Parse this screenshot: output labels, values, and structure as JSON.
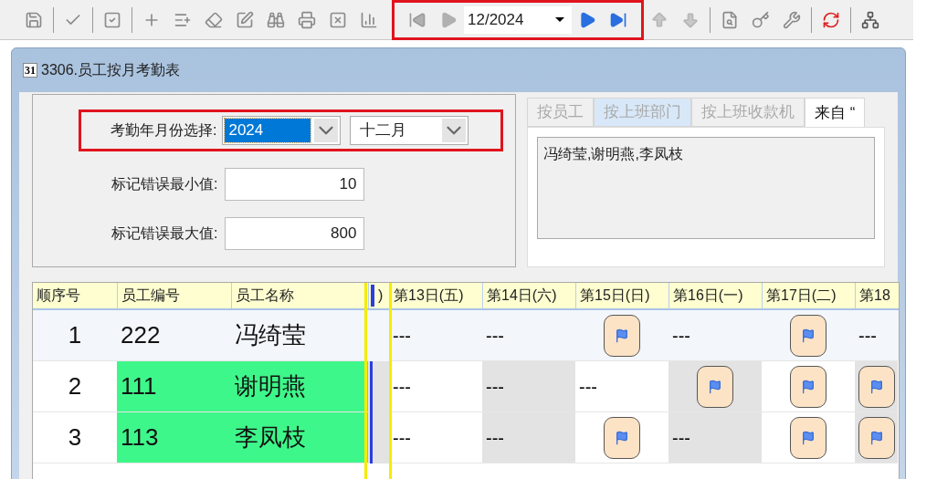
{
  "toolbar": {
    "period": "12/2024"
  },
  "window": {
    "title": "3306.员工按月考勤表",
    "icon_text": "31"
  },
  "filter": {
    "period_label": "考勤年月份选择:",
    "year": "2024",
    "month": "十二月",
    "min_label": "标记错误最小值:",
    "min_value": "10",
    "max_label": "标记错误最大值:",
    "max_value": "800"
  },
  "tabs": [
    {
      "label": "按员工",
      "selected": false,
      "hovered": false
    },
    {
      "label": "按上班部门",
      "selected": false,
      "hovered": true
    },
    {
      "label": "按上班收款机",
      "selected": false,
      "hovered": false
    },
    {
      "label": "来自 “",
      "selected": true,
      "hovered": false
    }
  ],
  "tab_content": "冯绮莹,谢明燕,李凤枝",
  "table": {
    "columns": [
      "顺序号",
      "员工编号",
      "员工名称",
      ")",
      "第13日(五)",
      "第14日(六)",
      "第15日(日)",
      "第16日(一)",
      "第17日(二)",
      "第18"
    ],
    "rows": [
      {
        "seq": "1",
        "id": "222",
        "name": "冯绮莹",
        "selected": true,
        "highlighted": false,
        "days": [
          {
            "kind": "dash",
            "text": "---",
            "shaded": false
          },
          {
            "kind": "dash",
            "text": "---",
            "shaded": false
          },
          {
            "kind": "flag",
            "shaded": false
          },
          {
            "kind": "dash",
            "text": "---",
            "shaded": false
          },
          {
            "kind": "flag",
            "shaded": false
          },
          {
            "kind": "dash",
            "text": "---",
            "shaded": false
          }
        ]
      },
      {
        "seq": "2",
        "id": "111",
        "name": "谢明燕",
        "selected": false,
        "highlighted": true,
        "days": [
          {
            "kind": "dash",
            "text": "---",
            "shaded": false
          },
          {
            "kind": "dash",
            "text": "---",
            "shaded": true
          },
          {
            "kind": "dash",
            "text": "---",
            "shaded": false
          },
          {
            "kind": "flag",
            "shaded": true
          },
          {
            "kind": "flag",
            "shaded": false
          },
          {
            "kind": "flag",
            "shaded": true
          }
        ]
      },
      {
        "seq": "3",
        "id": "113",
        "name": "李凤枝",
        "selected": false,
        "highlighted": true,
        "days": [
          {
            "kind": "dash",
            "text": "---",
            "shaded": false
          },
          {
            "kind": "dash",
            "text": "---",
            "shaded": true
          },
          {
            "kind": "flag",
            "shaded": false
          },
          {
            "kind": "dash",
            "text": "---",
            "shaded": true
          },
          {
            "kind": "flag",
            "shaded": false
          },
          {
            "kind": "flag",
            "shaded": true
          }
        ]
      }
    ]
  }
}
